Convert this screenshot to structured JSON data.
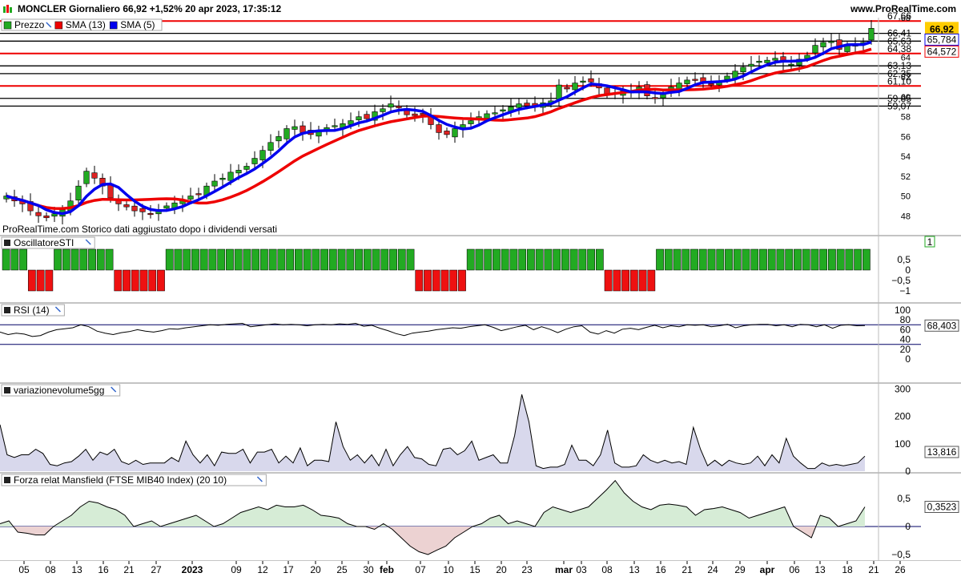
{
  "header": {
    "title": "MONCLER Giornaliero 66,92 +1,52% 20 apr 2023, 17:35:12",
    "site": "www.ProRealTime.com"
  },
  "watermark": "ProRealTime.com  Storico dati aggiustato dopo i dividendi versati",
  "panels": {
    "price": {
      "legend": [
        {
          "label": "Prezzo",
          "color": "#22aa22"
        },
        {
          "label": "SMA (13)",
          "color": "#ee0000"
        },
        {
          "label": "SMA (5)",
          "color": "#0000ee"
        }
      ],
      "ylim": [
        46,
        68
      ],
      "yticks": [
        "68",
        "64",
        "62",
        "60",
        "58",
        "56",
        "54",
        "52",
        "50",
        "48"
      ],
      "hlines_red": [
        67.66,
        64.38,
        61.1
      ],
      "hlines_black": [
        66.41,
        65.63,
        63.13,
        62.35,
        59.85,
        59.07
      ],
      "level_labels_red": [
        "67,66",
        "64,38",
        "61,10"
      ],
      "level_labels_black": [
        "66,41",
        "65,63",
        "63,13",
        "62,35",
        "59,85",
        "59,07"
      ],
      "badges": {
        "price": "66,92",
        "sma5": "65,784",
        "sma13": "64,572"
      },
      "badge_colors": {
        "price": "#ffcc00",
        "sma5": "#0000ee",
        "sma13": "#ee0000"
      }
    },
    "sti": {
      "title": "OscillatoreSTI",
      "yticks": [
        "0,5",
        "0",
        "−0,5",
        "−1"
      ],
      "badge": "1"
    },
    "rsi": {
      "title": "RSI (14)",
      "yticks": [
        "100",
        "80",
        "60",
        "40",
        "20",
        "0"
      ],
      "badge": "68,403"
    },
    "volume": {
      "title": "variazionevolume5gg",
      "yticks": [
        "300",
        "200",
        "100",
        "0"
      ],
      "badge": "13,816"
    },
    "mansfield": {
      "title": "Forza relat Mansfield (FTSE MIB40 Index) (20 10)",
      "yticks": [
        "0,5",
        "0",
        "−0,5"
      ],
      "badge": "0,3523"
    }
  },
  "x_axis": {
    "labels": [
      {
        "t": "05",
        "x": 30
      },
      {
        "t": "08",
        "x": 63
      },
      {
        "t": "13",
        "x": 96
      },
      {
        "t": "16",
        "x": 129
      },
      {
        "t": "21",
        "x": 161
      },
      {
        "t": "27",
        "x": 195
      },
      {
        "t": "2023",
        "x": 240,
        "bold": true
      },
      {
        "t": "09",
        "x": 295
      },
      {
        "t": "12",
        "x": 328
      },
      {
        "t": "17",
        "x": 360
      },
      {
        "t": "20",
        "x": 394
      },
      {
        "t": "25",
        "x": 427
      },
      {
        "t": "30",
        "x": 460
      },
      {
        "t": "feb",
        "x": 483,
        "bold": true
      },
      {
        "t": "07",
        "x": 525
      },
      {
        "t": "10",
        "x": 560
      },
      {
        "t": "15",
        "x": 593
      },
      {
        "t": "20",
        "x": 626
      },
      {
        "t": "23",
        "x": 658
      },
      {
        "t": "mar",
        "x": 704,
        "bold": true
      },
      {
        "t": "03",
        "x": 726
      },
      {
        "t": "08",
        "x": 758
      },
      {
        "t": "13",
        "x": 792
      },
      {
        "t": "16",
        "x": 825
      },
      {
        "t": "21",
        "x": 858
      },
      {
        "t": "24",
        "x": 890
      },
      {
        "t": "29",
        "x": 924
      },
      {
        "t": "apr",
        "x": 958,
        "bold": true
      },
      {
        "t": "06",
        "x": 992
      },
      {
        "t": "13",
        "x": 1024
      },
      {
        "t": "18",
        "x": 1058
      },
      {
        "t": "21",
        "x": 1091
      },
      {
        "t": "26",
        "x": 1124
      }
    ]
  },
  "chart_data": [
    {
      "type": "candlestick",
      "title": "MONCLER Giornaliero",
      "series_close": [
        50,
        49.5,
        49.2,
        48.5,
        48,
        47.8,
        48.2,
        48.6,
        49.5,
        51,
        52.5,
        51.8,
        51,
        49.8,
        49.2,
        48.9,
        48.5,
        48.4,
        48.2,
        48.6,
        49,
        49.3,
        49.6,
        50,
        50.2,
        51,
        51.5,
        51.8,
        52.4,
        52.6,
        53,
        53.8,
        54.6,
        55.4,
        56,
        56.8,
        57,
        56.4,
        56.2,
        56.5,
        56.9,
        57.1,
        57.3,
        57.6,
        58,
        57.8,
        58.5,
        58.8,
        59.3,
        58.9,
        58.2,
        58.1,
        58.2,
        57.2,
        56.4,
        56.2,
        56.8,
        57.2,
        57.6,
        58,
        58.3,
        58.4,
        58.7,
        59,
        59.3,
        59.1,
        59.1,
        59.4,
        59.6,
        61.2,
        60.8,
        61.4,
        61.6,
        61.5,
        60.9,
        60.2,
        60.4,
        60.6,
        60.4,
        61,
        60.1,
        59.9,
        60.3,
        61,
        61.4,
        61.7,
        61.7,
        61.5,
        61.2,
        61.6,
        62.1,
        62.6,
        63,
        63.3,
        63.6,
        63.7,
        63.9,
        63.5,
        63.3,
        63.8,
        64.2,
        65.2,
        65.5,
        65.6,
        64.8,
        65.2,
        65.3,
        65.5,
        66.92
      ],
      "sma13_last": 64.572,
      "sma5_last": 65.784
    },
    {
      "type": "bar",
      "title": "OscillatoreSTI",
      "values": [
        1,
        1,
        1,
        -1,
        -1,
        -1,
        1,
        1,
        1,
        1,
        1,
        1,
        1,
        -1,
        -1,
        -1,
        -1,
        -1,
        -1,
        1,
        1,
        1,
        1,
        1,
        1,
        1,
        1,
        1,
        1,
        1,
        1,
        1,
        1,
        1,
        1,
        1,
        1,
        1,
        1,
        1,
        1,
        1,
        1,
        1,
        1,
        1,
        1,
        1,
        -1,
        -1,
        -1,
        -1,
        -1,
        -1,
        1,
        1,
        1,
        1,
        1,
        1,
        1,
        1,
        1,
        1,
        1,
        1,
        1,
        1,
        1,
        1,
        -1,
        -1,
        -1,
        -1,
        -1,
        -1,
        1,
        1,
        1,
        1,
        1,
        1,
        1,
        1,
        1,
        1,
        1,
        1,
        1,
        1,
        1,
        1,
        1,
        1,
        1,
        1,
        1,
        1,
        1,
        1,
        1
      ],
      "ylim": [
        -1,
        1
      ]
    },
    {
      "type": "line",
      "title": "RSI (14)",
      "values": [
        55,
        50,
        53,
        51,
        46,
        48,
        55,
        60,
        62,
        64,
        70,
        66,
        57,
        53,
        50,
        54,
        56,
        60,
        57,
        55,
        58,
        62,
        61,
        64,
        66,
        68,
        70,
        69,
        71,
        72,
        73,
        66,
        68,
        70,
        72,
        70,
        71,
        70,
        68,
        70,
        71,
        70,
        72,
        71,
        73,
        67,
        69,
        63,
        58,
        52,
        48,
        53,
        55,
        57,
        60,
        62,
        64,
        63,
        66,
        68,
        70,
        65,
        58,
        62,
        66,
        69,
        60,
        66,
        61,
        54,
        61,
        66,
        68,
        55,
        51,
        58,
        53,
        61,
        63,
        60,
        65,
        69,
        64,
        68,
        66,
        70,
        69,
        70,
        66,
        68,
        71,
        64,
        68,
        70,
        71,
        71,
        68,
        70,
        66,
        71,
        70,
        66,
        70,
        63,
        69,
        70,
        68,
        68.403
      ],
      "ylim": [
        0,
        100
      ]
    },
    {
      "type": "area",
      "title": "variazionevolume5gg",
      "values": [
        170,
        60,
        50,
        60,
        60,
        80,
        65,
        25,
        20,
        30,
        35,
        55,
        80,
        40,
        70,
        60,
        80,
        35,
        25,
        40,
        25,
        30,
        30,
        30,
        50,
        35,
        110,
        60,
        30,
        60,
        20,
        70,
        65,
        65,
        80,
        30,
        70,
        70,
        80,
        30,
        55,
        30,
        85,
        20,
        40,
        40,
        35,
        180,
        90,
        40,
        60,
        30,
        60,
        20,
        80,
        20,
        60,
        90,
        50,
        45,
        25,
        20,
        80,
        85,
        60,
        75,
        110,
        40,
        50,
        60,
        30,
        30,
        130,
        280,
        180,
        20,
        10,
        15,
        15,
        25,
        95,
        40,
        40,
        20,
        60,
        150,
        30,
        15,
        15,
        20,
        60,
        40,
        30,
        40,
        30,
        35,
        25,
        160,
        80,
        20,
        40,
        20,
        40,
        30,
        25,
        30,
        55,
        20,
        60,
        30,
        120,
        55,
        30,
        10,
        10,
        30,
        20,
        25,
        20,
        25,
        30,
        55
      ],
      "ylim": [
        0,
        300
      ]
    },
    {
      "type": "area",
      "title": "Forza relat Mansfield (FTSE MIB40 Index) (20 10)",
      "values": [
        0.05,
        0.1,
        -0.1,
        -0.12,
        -0.15,
        -0.15,
        0.0,
        0.1,
        0.2,
        0.35,
        0.45,
        0.42,
        0.35,
        0.3,
        0.2,
        0.0,
        0.05,
        0.1,
        0.0,
        0.05,
        0.1,
        0.15,
        0.2,
        0.1,
        0.0,
        0.05,
        0.15,
        0.25,
        0.3,
        0.35,
        0.3,
        0.38,
        0.35,
        0.35,
        0.38,
        0.3,
        0.2,
        0.18,
        0.15,
        0.05,
        0.0,
        0.0,
        -0.05,
        0.05,
        -0.05,
        -0.2,
        -0.35,
        -0.45,
        -0.5,
        -0.42,
        -0.35,
        -0.2,
        -0.1,
        0.0,
        0.05,
        0.15,
        0.2,
        0.05,
        0.1,
        0.05,
        0.0,
        0.25,
        0.35,
        0.3,
        0.25,
        0.3,
        0.35,
        0.5,
        0.65,
        0.82,
        0.6,
        0.45,
        0.35,
        0.3,
        0.38,
        0.4,
        0.38,
        0.35,
        0.2,
        0.3,
        0.32,
        0.35,
        0.3,
        0.25,
        0.15,
        0.2,
        0.25,
        0.3,
        0.35,
        0.0,
        -0.1,
        -0.2,
        0.2,
        0.15,
        0.0,
        0.05,
        0.1,
        0.35
      ],
      "ylim": [
        -0.6,
        1.0
      ]
    }
  ]
}
